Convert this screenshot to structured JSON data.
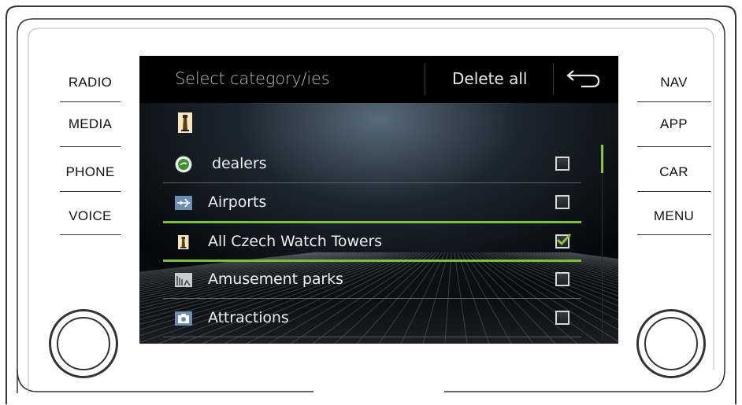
{
  "hardware": {
    "left_buttons": [
      "RADIO",
      "MEDIA",
      "PHONE",
      "VOICE"
    ],
    "right_buttons": [
      "NAV",
      "APP",
      "CAR",
      "MENU"
    ]
  },
  "header": {
    "title": "Select category/ies",
    "delete_all_label": "Delete all",
    "back_icon": "back-arrow-icon"
  },
  "category_header_icon": "watch-tower-icon",
  "categories": [
    {
      "icon": "skoda-logo-icon",
      "label": "dealers",
      "checked": false
    },
    {
      "icon": "airport-icon",
      "label": "Airports",
      "checked": false
    },
    {
      "icon": "watch-tower-icon",
      "label": "All Czech Watch Towers",
      "checked": true
    },
    {
      "icon": "amusement-park-icon",
      "label": "Amusement parks",
      "checked": false
    },
    {
      "icon": "camera-icon",
      "label": "Attractions",
      "checked": false
    }
  ],
  "colors": {
    "accent": "#7bbf3a",
    "screen_bg": "#0a0d10",
    "text": "#eceef0"
  }
}
